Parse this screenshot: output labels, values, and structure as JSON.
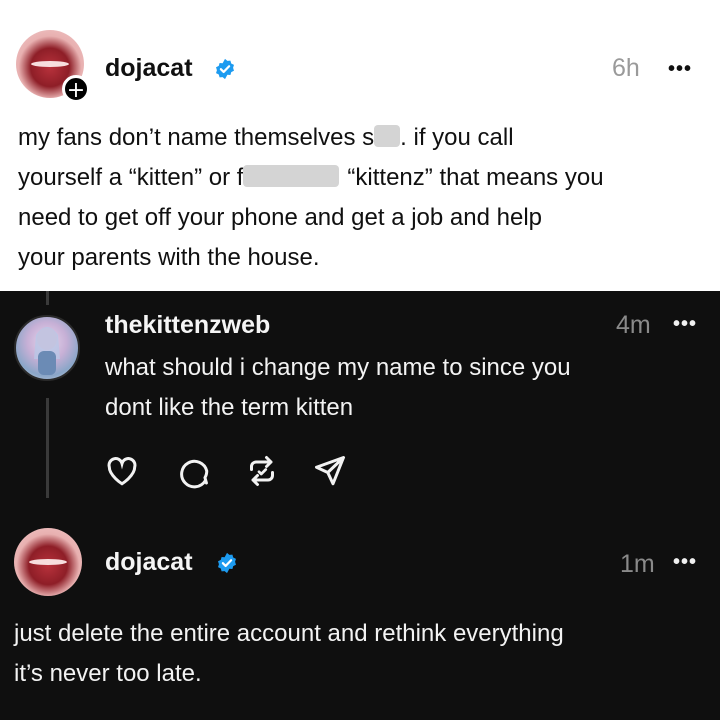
{
  "post": {
    "username": "dojacat",
    "time": "6h",
    "more": "•••",
    "line1a": "my fans don’t name themselves s",
    "line1b": ". if you call",
    "line2a": "yourself a “kitten” or f",
    "line2b": "“kittenz” that means you",
    "line3": "need to get off your phone and get a job and help",
    "line4": "your parents with the house."
  },
  "reply": {
    "username": "thekittenzweb",
    "time": "4m",
    "more": "•••",
    "line1": "what should i change my name to since you",
    "line2": "dont like the term kitten"
  },
  "answer": {
    "username": "dojacat",
    "time": "1m",
    "more": "•••",
    "line1": "just delete the entire account and rethink everything",
    "line2": "it’s never too late."
  },
  "icons": [
    "like-icon",
    "comment-icon",
    "repost-icon",
    "share-icon",
    "verified-badge-icon",
    "follow-plus-icon"
  ],
  "colors": {
    "verified": "#1d9bf0",
    "dark_bg": "#0f0f0f",
    "light_bg": "#ffffff",
    "muted": "#9a9a9a"
  }
}
